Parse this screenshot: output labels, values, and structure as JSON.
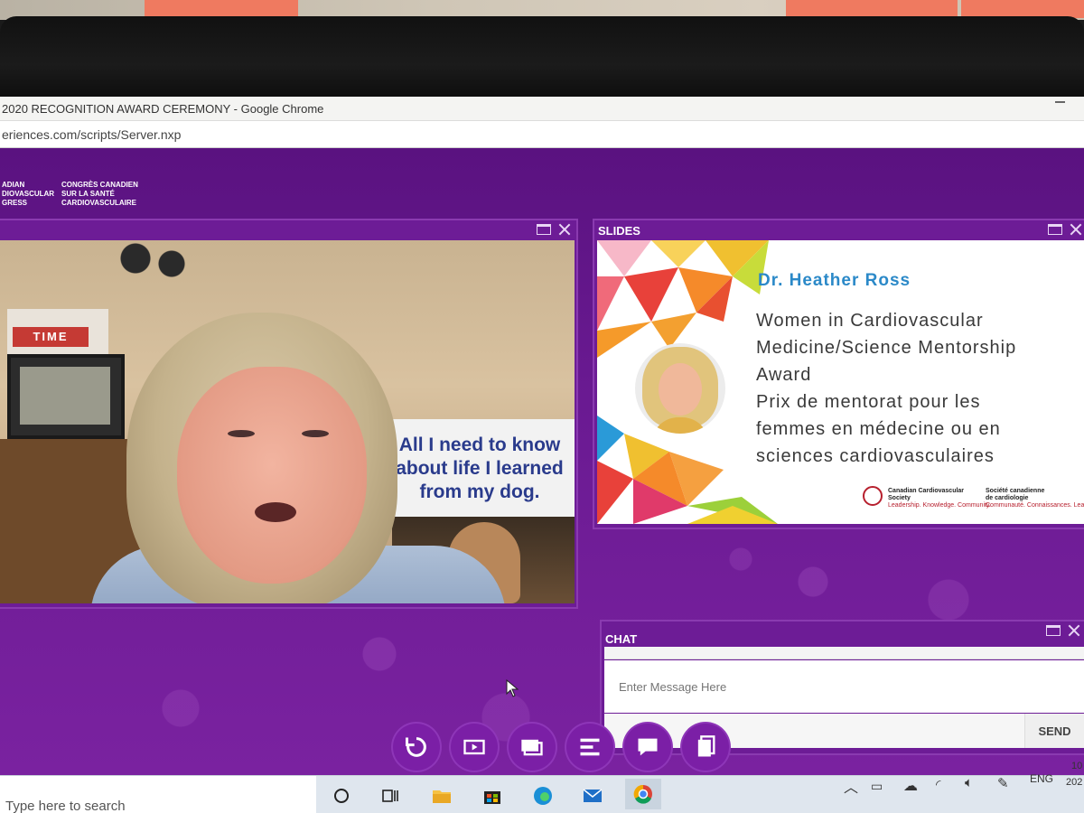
{
  "browser": {
    "window_title": "2020 RECOGNITION AWARD CEREMONY - Google Chrome",
    "url": "eriences.com/scripts/Server.nxp"
  },
  "header": {
    "logo_en": [
      "ADIAN",
      "DIOVASCULAR",
      "GRESS"
    ],
    "logo_fr": [
      "CONGRÈS CANADIEN",
      "SUR LA SANTÉ",
      "CARDIOVASCULAIRE"
    ]
  },
  "video": {
    "sign_lines": [
      "All I need to know",
      "about life I learned",
      "from my dog."
    ],
    "book_label": "TIME"
  },
  "slides_panel": {
    "label": "SLIDES",
    "heading": "Dr. Heather Ross",
    "body_lines": [
      "Women in Cardiovascular",
      "Medicine/Science Mentorship",
      "Award",
      "Prix de mentorat pour les",
      "femmes en médecine ou en",
      "sciences cardiovasculaires"
    ],
    "footer_en": [
      "Canadian Cardiovascular",
      "Society",
      "Leadership. Knowledge. Community."
    ],
    "footer_fr": [
      "Société canadienne",
      "de cardiologie",
      "Communauté. Connaissances. Leadership."
    ]
  },
  "chat": {
    "label": "CHAT",
    "input_placeholder": "Enter Message Here",
    "send_label": "SEND"
  },
  "toolbar": {
    "items": [
      "refresh-icon",
      "video-icon",
      "slides-icon",
      "agenda-icon",
      "chat-icon",
      "documents-icon"
    ]
  },
  "taskbar": {
    "search_placeholder": "Type here to search",
    "language": "ENG",
    "clock_time": "10",
    "clock_date": "202"
  },
  "colors": {
    "page_purple": "#6a1a92",
    "slide_heading_blue": "#2b89c8"
  }
}
